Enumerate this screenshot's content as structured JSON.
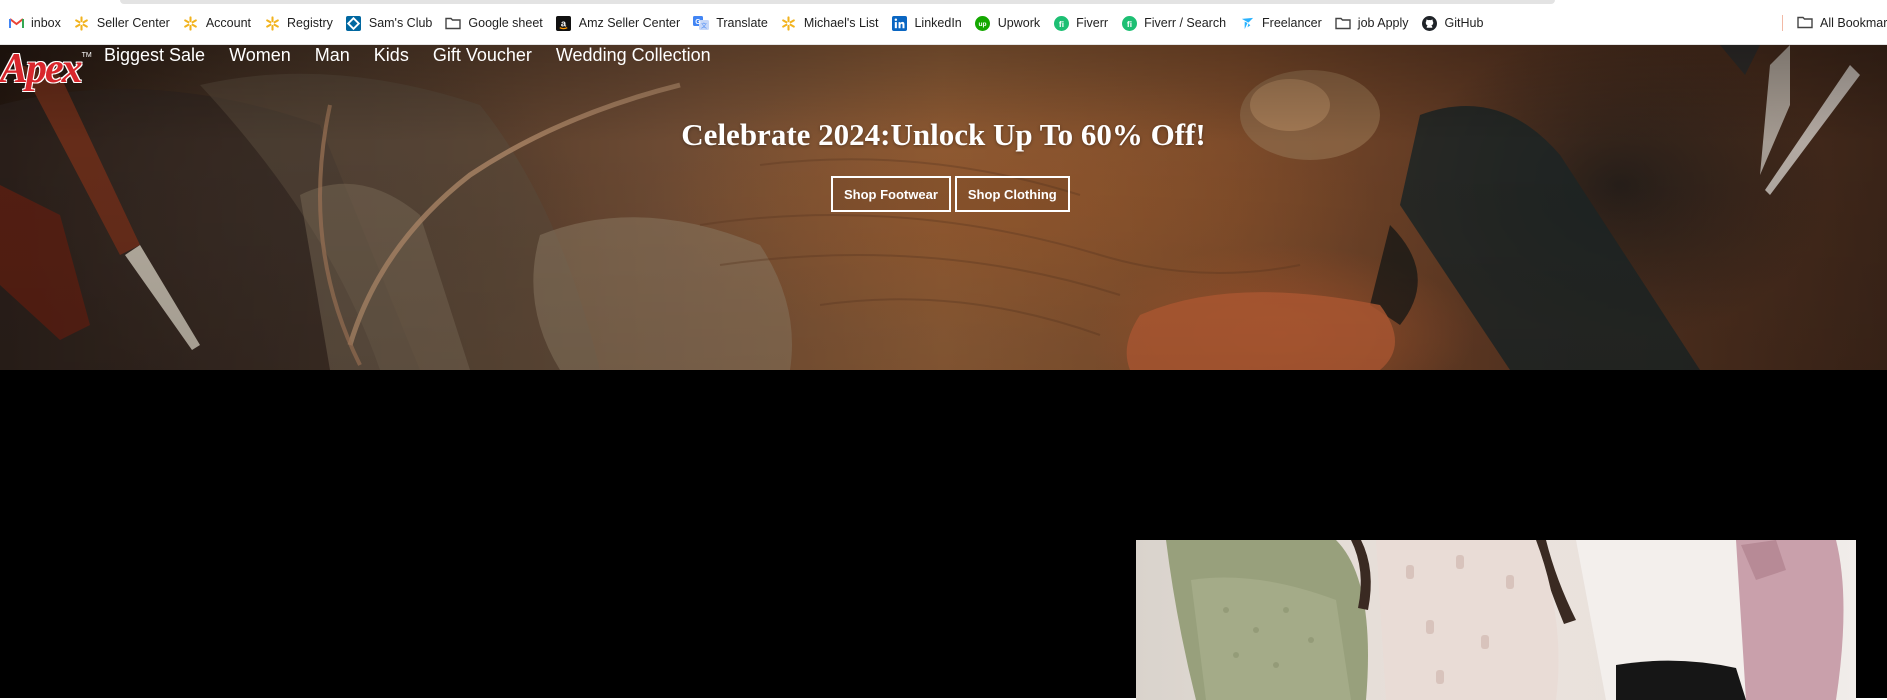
{
  "bookmarks": {
    "items": [
      {
        "label": "inbox",
        "icon": "gmail-icon"
      },
      {
        "label": "Seller Center",
        "icon": "walmart-spark-icon"
      },
      {
        "label": "Account",
        "icon": "walmart-spark-icon"
      },
      {
        "label": "Registry",
        "icon": "walmart-spark-icon"
      },
      {
        "label": "Sam's Club",
        "icon": "sams-club-icon"
      },
      {
        "label": "Google sheet",
        "icon": "folder-icon"
      },
      {
        "label": "Amz Seller Center",
        "icon": "amazon-icon"
      },
      {
        "label": "Translate",
        "icon": "translate-icon"
      },
      {
        "label": "Michael's List",
        "icon": "walmart-spark-icon"
      },
      {
        "label": "LinkedIn",
        "icon": "linkedin-icon"
      },
      {
        "label": "Upwork",
        "icon": "upwork-icon"
      },
      {
        "label": "Fiverr",
        "icon": "fiverr-icon"
      },
      {
        "label": "Fiverr / Search",
        "icon": "fiverr-icon"
      },
      {
        "label": "Freelancer",
        "icon": "freelancer-icon"
      },
      {
        "label": "job Apply",
        "icon": "folder-icon"
      },
      {
        "label": "GitHub",
        "icon": "github-icon"
      }
    ],
    "all_bookmarks": "All Bookmarks"
  },
  "site": {
    "logo_text": "Apex",
    "logo_tm": "TM",
    "brand_color": "#d8262c"
  },
  "nav": {
    "items": [
      "Biggest Sale",
      "Women",
      "Man",
      "Kids",
      "Gift Voucher",
      "Wedding Collection"
    ]
  },
  "hero": {
    "title": "Celebrate 2024:Unlock Up To 60% Off!",
    "buttons": [
      "Shop Footwear",
      "Shop Clothing"
    ]
  }
}
